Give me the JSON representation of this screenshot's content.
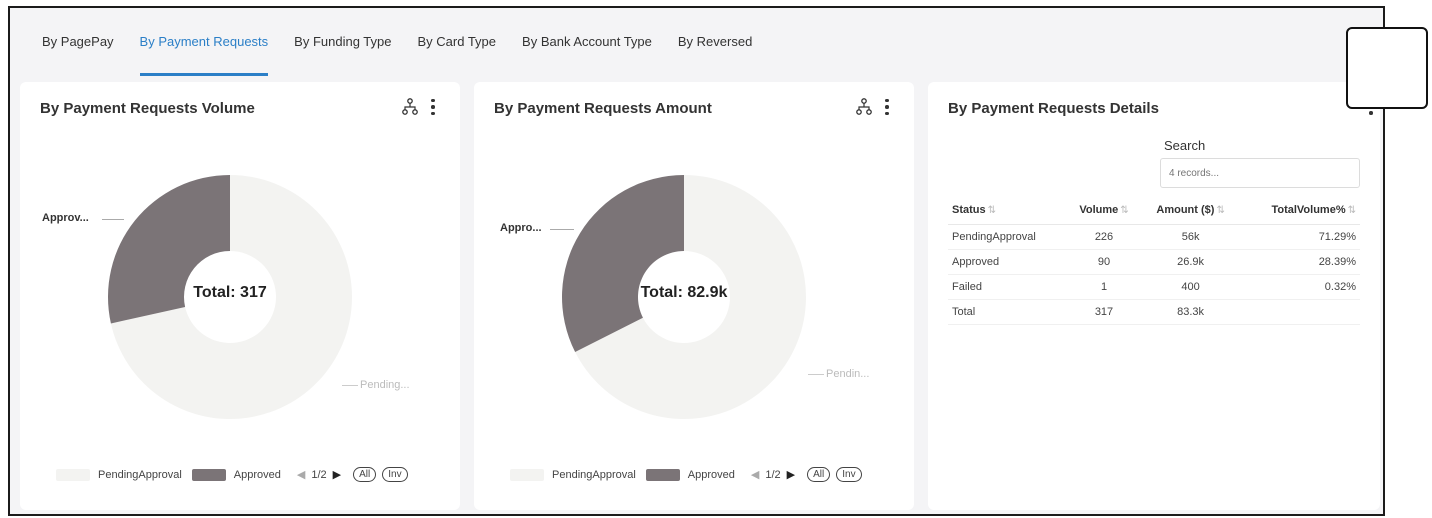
{
  "tabs": [
    {
      "label": "By PagePay"
    },
    {
      "label": "By Payment Requests"
    },
    {
      "label": "By Funding Type"
    },
    {
      "label": "By Card Type"
    },
    {
      "label": "By Bank Account Type"
    },
    {
      "label": "By Reversed"
    }
  ],
  "volume_card": {
    "title": "By Payment Requests Volume",
    "total_label": "Total: 317",
    "callout_dark": "Approv...",
    "callout_light": "Pending...",
    "legend": {
      "item1": "PendingApproval",
      "item2": "Approved",
      "pager": "1/2",
      "all": "All",
      "inv": "Inv"
    }
  },
  "amount_card": {
    "title": "By Payment Requests Amount",
    "total_label": "Total: 82.9k",
    "callout_dark": "Appro...",
    "callout_light": "Pendin...",
    "legend": {
      "item1": "PendingApproval",
      "item2": "Approved",
      "pager": "1/2",
      "all": "All",
      "inv": "Inv"
    }
  },
  "details_card": {
    "title": "By Payment Requests Details",
    "search_label": "Search",
    "search_placeholder": "4 records...",
    "columns": [
      "Status",
      "Volume",
      "Amount ($)",
      "TotalVolume%"
    ],
    "rows": [
      [
        "PendingApproval",
        "226",
        "56k",
        "71.29%"
      ],
      [
        "Approved",
        "90",
        "26.9k",
        "28.39%"
      ],
      [
        "Failed",
        "1",
        "400",
        "0.32%"
      ],
      [
        "Total",
        "317",
        "83.3k",
        ""
      ]
    ]
  },
  "chart_data": [
    {
      "type": "pie",
      "categories": [
        "PendingApproval",
        "Approved"
      ],
      "values": [
        226,
        90
      ],
      "colors": [
        "#f3f3f1",
        "#7b7477"
      ],
      "center_label": "Total: 317"
    },
    {
      "type": "pie",
      "categories": [
        "PendingApproval",
        "Approved"
      ],
      "values": [
        56000,
        26900
      ],
      "colors": [
        "#f3f3f1",
        "#7b7477"
      ],
      "center_label": "Total: 82.9k"
    }
  ],
  "colors": {
    "accent": "#2b7fc7",
    "approved": "#7b7477",
    "pending": "#f3f3f1"
  },
  "icons": {
    "chart_type": "hierarchy-icon",
    "menu": "kebab-menu-icon"
  }
}
